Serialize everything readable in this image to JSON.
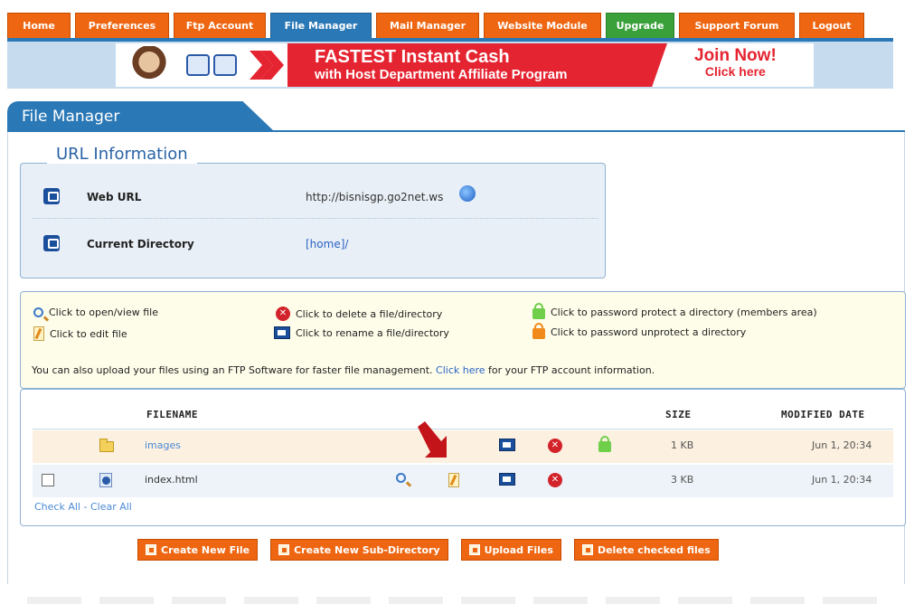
{
  "nav": {
    "tabs": [
      {
        "label": "Home"
      },
      {
        "label": "Preferences"
      },
      {
        "label": "Ftp Account"
      },
      {
        "label": "File Manager"
      },
      {
        "label": "Mail Manager"
      },
      {
        "label": "Website Module"
      },
      {
        "label": "Upgrade"
      },
      {
        "label": "Support Forum"
      },
      {
        "label": "Logout"
      }
    ],
    "active_tab": "File Manager"
  },
  "banner": {
    "headline": "FASTEST Instant Cash",
    "subline": "with Host Department Affiliate Program",
    "cta": "Join Now!",
    "cta_sub": "Click here"
  },
  "section": {
    "title": "File Manager"
  },
  "url_info": {
    "title": "URL Information",
    "web_url_label": "Web URL",
    "web_url_value": "http://bisnisgp.go2net.ws",
    "current_dir_label": "Current Directory",
    "current_dir_value": "[home]/"
  },
  "legend": {
    "open": "Click to open/view file",
    "edit": "Click to edit file",
    "delete": "Click to delete a file/directory",
    "rename": "Click to rename a file/directory",
    "protect": "Click to password protect a directory (members area)",
    "unprotect": "Click to password unprotect a directory",
    "note_before": "You can also upload your files using an FTP Software for faster file management.",
    "note_link": "Click here",
    "note_after": "for your FTP account information."
  },
  "table": {
    "headers": {
      "filename": "FILENAME",
      "size": "SIZE",
      "modified": "MODIFIED DATE"
    },
    "rows": [
      {
        "name": "images",
        "size": "1 KB",
        "modified": "Jun 1, 20:34"
      },
      {
        "name": "index.html",
        "size": "3 KB",
        "modified": "Jun 1, 20:34"
      }
    ],
    "check_all": "Check All",
    "separator": " - ",
    "clear_all": "Clear All"
  },
  "buttons": {
    "create_file": "Create New File",
    "create_dir": "Create New Sub-Directory",
    "upload": "Upload Files",
    "delete_checked": "Delete checked files"
  },
  "colors": {
    "tab_orange": "#ee6611",
    "tab_active": "#2a78b6",
    "tab_upgrade": "#3aa03a",
    "banner_red": "#e52431",
    "link_blue": "#2a63c6",
    "legend_bg": "#fefdea"
  },
  "icons": {
    "open": "magnifier-icon",
    "edit": "edit-pencil-icon",
    "delete": "delete-x-icon",
    "rename": "rename-icon",
    "protect": "lock-green-icon",
    "unprotect": "lock-orange-icon",
    "folder": "folder-icon",
    "html": "html-file-icon"
  }
}
